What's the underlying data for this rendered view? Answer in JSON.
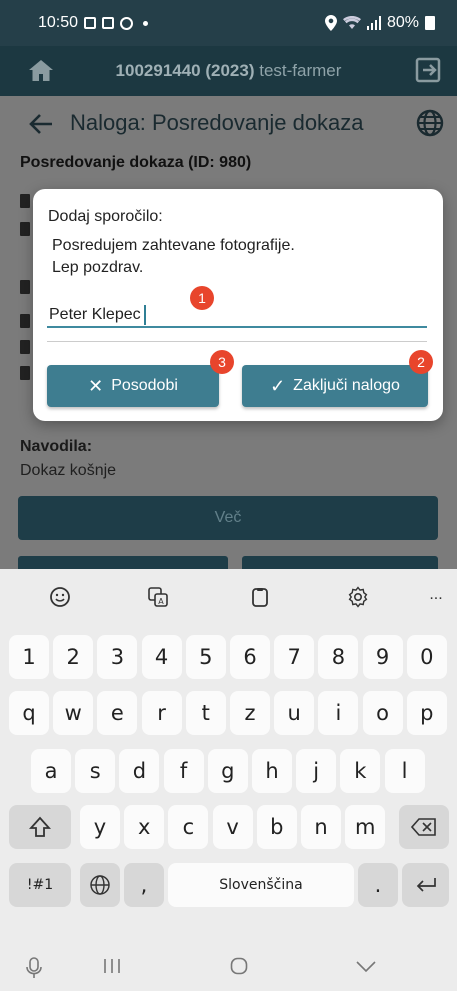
{
  "status_bar": {
    "time": "10:50",
    "battery": "80%",
    "left_icons": [
      "gallery-icon",
      "image-icon",
      "media-icon"
    ],
    "right_icons": [
      "location-icon",
      "wifi-icon",
      "signal-icon",
      "battery-icon"
    ]
  },
  "app_header": {
    "id_text": "100291440 (2023)",
    "user": "test-farmer",
    "icons": [
      "home-icon",
      "logout-icon"
    ]
  },
  "page": {
    "nav_title": "Naloga: Posredovanje dokaza",
    "section_title": "Posredovanje dokaza (ID: 980)",
    "instructions_label": "Navodila:",
    "instructions_text": "Dokaz košnje",
    "more_button": "Več"
  },
  "dialog": {
    "label": "Dodaj sporočilo:",
    "message": "Posredujem zahtevane fotografije.\nLep pozdrav.",
    "input_value": "Peter Klepec",
    "update_button": "Posodobi",
    "finish_button": "Zaključi nalogo",
    "badges": [
      "1",
      "2",
      "3"
    ]
  },
  "keyboard": {
    "toolbar": [
      "emoji-icon",
      "translate-icon",
      "clipboard-icon",
      "settings-icon",
      "more-icon"
    ],
    "more_label": "...",
    "row_numbers": [
      "1",
      "2",
      "3",
      "4",
      "5",
      "6",
      "7",
      "8",
      "9",
      "0"
    ],
    "row_1": [
      "q",
      "w",
      "e",
      "r",
      "t",
      "z",
      "u",
      "i",
      "o",
      "p"
    ],
    "row_2": [
      "a",
      "s",
      "d",
      "f",
      "g",
      "h",
      "j",
      "k",
      "l"
    ],
    "row_3": [
      "y",
      "x",
      "c",
      "v",
      "b",
      "n",
      "m"
    ],
    "symbols_key": "!#1",
    "comma_key": ",",
    "space_label": "Slovenščina",
    "period_key": "."
  },
  "colors": {
    "header_bg": "#1c3841",
    "primary_button": "#3e7d90",
    "badge": "#e8452c",
    "input_underline": "#3f8a9f"
  }
}
